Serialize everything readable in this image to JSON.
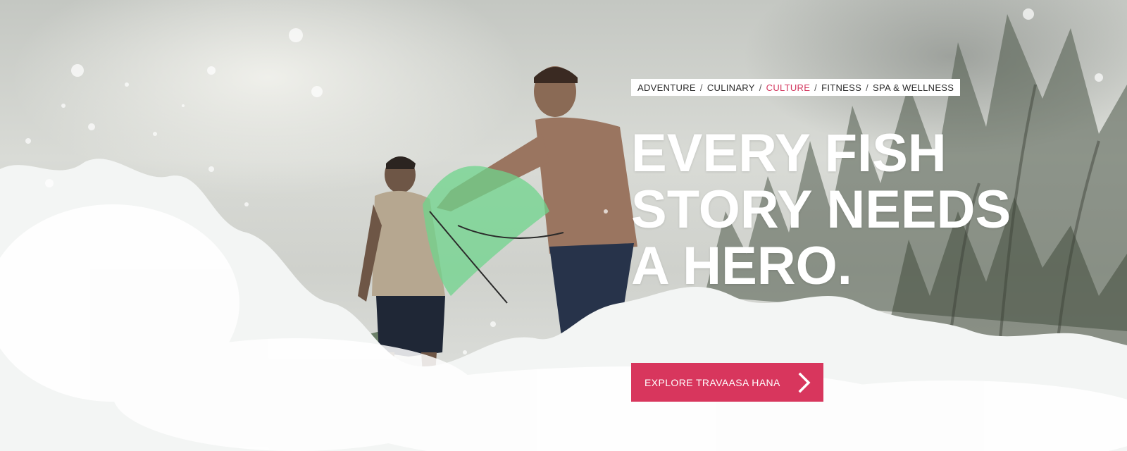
{
  "nav": {
    "items": [
      {
        "label": "ADVENTURE",
        "active": false
      },
      {
        "label": "CULINARY",
        "active": false
      },
      {
        "label": "CULTURE",
        "active": true
      },
      {
        "label": "FITNESS",
        "active": false
      },
      {
        "label": "SPA & WELLNESS",
        "active": false
      }
    ],
    "separator": "/"
  },
  "headline": {
    "lines": [
      "EVERY FISH",
      "STORY NEEDS",
      "A HERO."
    ]
  },
  "cta": {
    "label": "EXPLORE TRAVAASA HANA",
    "icon": "chevron-right-icon"
  },
  "colors": {
    "accent": "#d8365d",
    "active_nav": "#d3365e",
    "headline": "#ffffff"
  }
}
